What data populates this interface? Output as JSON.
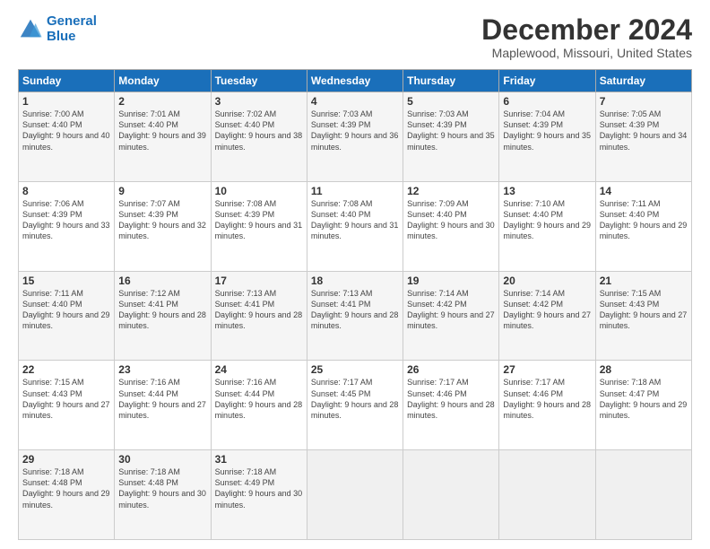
{
  "header": {
    "logo_line1": "General",
    "logo_line2": "Blue",
    "month_title": "December 2024",
    "location": "Maplewood, Missouri, United States"
  },
  "days_of_week": [
    "Sunday",
    "Monday",
    "Tuesday",
    "Wednesday",
    "Thursday",
    "Friday",
    "Saturday"
  ],
  "weeks": [
    [
      {
        "num": "1",
        "sunrise": "7:00 AM",
        "sunset": "4:40 PM",
        "daylight": "9 hours and 40 minutes."
      },
      {
        "num": "2",
        "sunrise": "7:01 AM",
        "sunset": "4:40 PM",
        "daylight": "9 hours and 39 minutes."
      },
      {
        "num": "3",
        "sunrise": "7:02 AM",
        "sunset": "4:40 PM",
        "daylight": "9 hours and 38 minutes."
      },
      {
        "num": "4",
        "sunrise": "7:03 AM",
        "sunset": "4:39 PM",
        "daylight": "9 hours and 36 minutes."
      },
      {
        "num": "5",
        "sunrise": "7:03 AM",
        "sunset": "4:39 PM",
        "daylight": "9 hours and 35 minutes."
      },
      {
        "num": "6",
        "sunrise": "7:04 AM",
        "sunset": "4:39 PM",
        "daylight": "9 hours and 35 minutes."
      },
      {
        "num": "7",
        "sunrise": "7:05 AM",
        "sunset": "4:39 PM",
        "daylight": "9 hours and 34 minutes."
      }
    ],
    [
      {
        "num": "8",
        "sunrise": "7:06 AM",
        "sunset": "4:39 PM",
        "daylight": "9 hours and 33 minutes."
      },
      {
        "num": "9",
        "sunrise": "7:07 AM",
        "sunset": "4:39 PM",
        "daylight": "9 hours and 32 minutes."
      },
      {
        "num": "10",
        "sunrise": "7:08 AM",
        "sunset": "4:39 PM",
        "daylight": "9 hours and 31 minutes."
      },
      {
        "num": "11",
        "sunrise": "7:08 AM",
        "sunset": "4:40 PM",
        "daylight": "9 hours and 31 minutes."
      },
      {
        "num": "12",
        "sunrise": "7:09 AM",
        "sunset": "4:40 PM",
        "daylight": "9 hours and 30 minutes."
      },
      {
        "num": "13",
        "sunrise": "7:10 AM",
        "sunset": "4:40 PM",
        "daylight": "9 hours and 29 minutes."
      },
      {
        "num": "14",
        "sunrise": "7:11 AM",
        "sunset": "4:40 PM",
        "daylight": "9 hours and 29 minutes."
      }
    ],
    [
      {
        "num": "15",
        "sunrise": "7:11 AM",
        "sunset": "4:40 PM",
        "daylight": "9 hours and 29 minutes."
      },
      {
        "num": "16",
        "sunrise": "7:12 AM",
        "sunset": "4:41 PM",
        "daylight": "9 hours and 28 minutes."
      },
      {
        "num": "17",
        "sunrise": "7:13 AM",
        "sunset": "4:41 PM",
        "daylight": "9 hours and 28 minutes."
      },
      {
        "num": "18",
        "sunrise": "7:13 AM",
        "sunset": "4:41 PM",
        "daylight": "9 hours and 28 minutes."
      },
      {
        "num": "19",
        "sunrise": "7:14 AM",
        "sunset": "4:42 PM",
        "daylight": "9 hours and 27 minutes."
      },
      {
        "num": "20",
        "sunrise": "7:14 AM",
        "sunset": "4:42 PM",
        "daylight": "9 hours and 27 minutes."
      },
      {
        "num": "21",
        "sunrise": "7:15 AM",
        "sunset": "4:43 PM",
        "daylight": "9 hours and 27 minutes."
      }
    ],
    [
      {
        "num": "22",
        "sunrise": "7:15 AM",
        "sunset": "4:43 PM",
        "daylight": "9 hours and 27 minutes."
      },
      {
        "num": "23",
        "sunrise": "7:16 AM",
        "sunset": "4:44 PM",
        "daylight": "9 hours and 27 minutes."
      },
      {
        "num": "24",
        "sunrise": "7:16 AM",
        "sunset": "4:44 PM",
        "daylight": "9 hours and 28 minutes."
      },
      {
        "num": "25",
        "sunrise": "7:17 AM",
        "sunset": "4:45 PM",
        "daylight": "9 hours and 28 minutes."
      },
      {
        "num": "26",
        "sunrise": "7:17 AM",
        "sunset": "4:46 PM",
        "daylight": "9 hours and 28 minutes."
      },
      {
        "num": "27",
        "sunrise": "7:17 AM",
        "sunset": "4:46 PM",
        "daylight": "9 hours and 28 minutes."
      },
      {
        "num": "28",
        "sunrise": "7:18 AM",
        "sunset": "4:47 PM",
        "daylight": "9 hours and 29 minutes."
      }
    ],
    [
      {
        "num": "29",
        "sunrise": "7:18 AM",
        "sunset": "4:48 PM",
        "daylight": "9 hours and 29 minutes."
      },
      {
        "num": "30",
        "sunrise": "7:18 AM",
        "sunset": "4:48 PM",
        "daylight": "9 hours and 30 minutes."
      },
      {
        "num": "31",
        "sunrise": "7:18 AM",
        "sunset": "4:49 PM",
        "daylight": "9 hours and 30 minutes."
      },
      null,
      null,
      null,
      null
    ]
  ]
}
